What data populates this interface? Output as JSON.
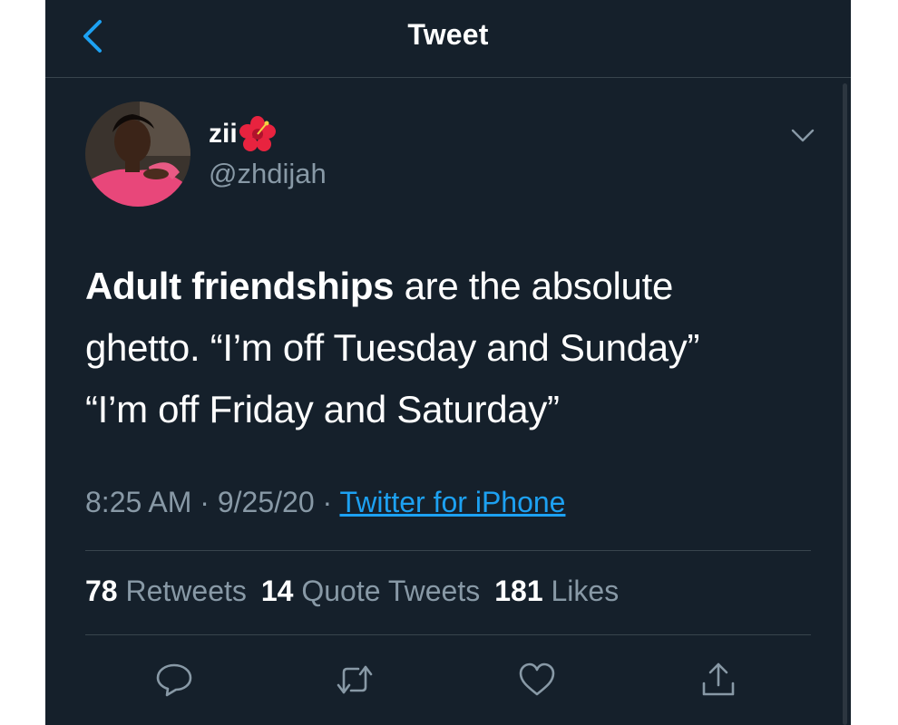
{
  "header": {
    "title": "Tweet",
    "back_icon": "chevron-left-icon"
  },
  "tweet": {
    "author": {
      "display_name": "zii",
      "name_emoji": "hibiscus-icon",
      "handle": "@zhdijah"
    },
    "text_bold": "Adult friendships",
    "text_rest_line1": " are the absolute",
    "text_line2": "ghetto. “I’m off Tuesday and Sunday”",
    "text_line3": "“I’m off Friday and Saturday”",
    "time": "8:25 AM",
    "separator": "·",
    "date": "9/25/20",
    "source": "Twitter for iPhone"
  },
  "stats": {
    "retweets_count": "78",
    "retweets_label": "Retweets",
    "quotes_count": "14",
    "quotes_label": "Quote Tweets",
    "likes_count": "181",
    "likes_label": "Likes"
  },
  "actions": [
    "reply-icon",
    "retweet-icon",
    "like-icon",
    "share-icon"
  ],
  "colors": {
    "background": "#15202b",
    "accent": "#1da1f2",
    "secondary_text": "#8899a6",
    "divider": "#38444d"
  }
}
